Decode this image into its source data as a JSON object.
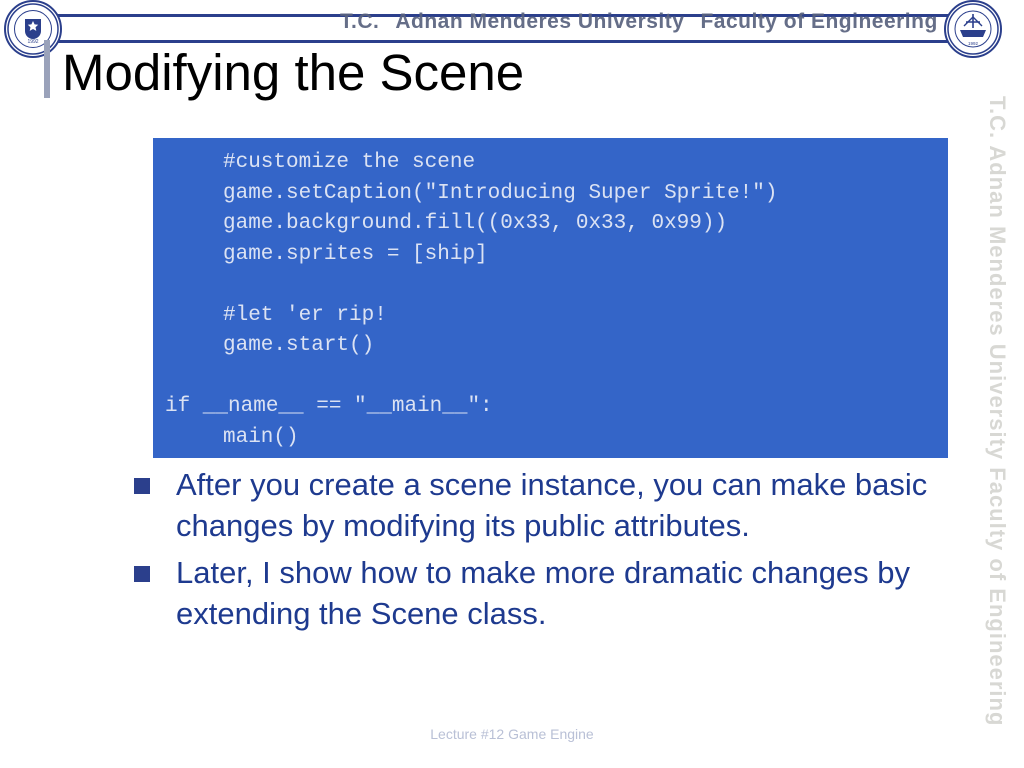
{
  "header": {
    "institution_line": [
      "T.C.",
      "Adnan Menderes University",
      "Faculty of Engineering"
    ],
    "left_logo_name": "adnan-menderes-university-seal",
    "right_logo_name": "engineering-faculty-seal",
    "left_logo_text_top": "ADNAN MENDERES",
    "left_logo_text_bottom": "ÜNIVERSITESI",
    "right_logo_text_top": "ADNAN MENDERES UNIVERSITY",
    "right_logo_text_bottom": "ENGINEERING FACULTY"
  },
  "slide": {
    "title": "Modifying the Scene",
    "code_lines": [
      {
        "text": "#customize the scene",
        "indent": true
      },
      {
        "text": "game.setCaption(\"Introducing Super Sprite!\")",
        "indent": true
      },
      {
        "text": "game.background.fill((0x33, 0x33, 0x99))",
        "indent": true
      },
      {
        "text": "game.sprites = [ship]",
        "indent": true
      },
      {
        "text": "",
        "indent": true
      },
      {
        "text": "#let 'er rip!",
        "indent": true
      },
      {
        "text": "game.start()",
        "indent": true
      },
      {
        "text": "",
        "indent": true
      },
      {
        "text": "if __name__ == \"__main__\":",
        "indent": false
      },
      {
        "text": "main()",
        "indent": true
      }
    ],
    "bullets": [
      "After you create a scene instance, you can make basic changes by modifying its public attributes.",
      "Later, I show how to make more dramatic changes by extending the Scene class."
    ]
  },
  "side_text": "T.C.   Adnan Menderes University   Faculty of Engineering",
  "footer": "Lecture #12 Game Engine",
  "colors": {
    "code_bg": "#3465c8",
    "bullet_text": "#1e3a8f",
    "header_rule": "#2b3f8c",
    "footer_text": "#b9c0d6"
  }
}
